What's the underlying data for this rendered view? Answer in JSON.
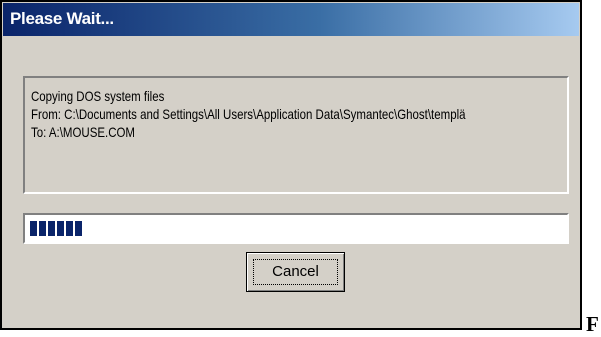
{
  "window": {
    "title": "Please Wait..."
  },
  "message": {
    "lines": [
      "Copying DOS system files",
      "From: C:\\Documents and Settings\\All Users\\Application Data\\Symantec\\Ghost\\templä",
      "To: A:\\MOUSE.COM"
    ]
  },
  "progress": {
    "fraction": 0.105,
    "color": "#0a246a"
  },
  "buttons": {
    "cancel_label": "Cancel"
  },
  "outside_text": "F",
  "colors": {
    "titlebar_start": "#0a246a",
    "titlebar_end": "#a6caf0",
    "dialog_bg": "#d4d0c8"
  }
}
